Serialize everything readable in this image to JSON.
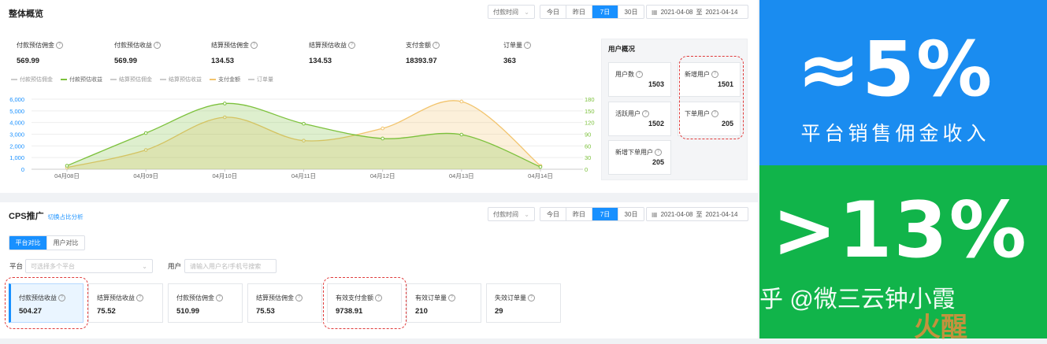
{
  "overview": {
    "title": "整体概览",
    "pay_time_label": "付款时间",
    "ranges": [
      "今日",
      "昨日",
      "7日",
      "30日"
    ],
    "active_range": "7日",
    "date_from": "2021-04-08",
    "date_sep": "至",
    "date_to": "2021-04-14",
    "metrics": [
      {
        "label": "付款预估佣金",
        "value": "569.99"
      },
      {
        "label": "付款预估收益",
        "value": "569.99"
      },
      {
        "label": "结算预估佣金",
        "value": "134.53"
      },
      {
        "label": "结算预估收益",
        "value": "134.53"
      },
      {
        "label": "支付金额",
        "value": "18393.97"
      },
      {
        "label": "订单量",
        "value": "363"
      }
    ]
  },
  "chart_data": {
    "type": "area",
    "categories": [
      "04月08日",
      "04月09日",
      "04月10日",
      "04月11日",
      "04月12日",
      "04月13日",
      "04月14日"
    ],
    "legend": [
      {
        "name": "付款预估佣金",
        "color": "#cccccc"
      },
      {
        "name": "付款预估收益",
        "color": "#7cc13c"
      },
      {
        "name": "结算预估佣金",
        "color": "#cccccc"
      },
      {
        "name": "结算预估收益",
        "color": "#cccccc"
      },
      {
        "name": "支付金额",
        "color": "#f2c46d"
      },
      {
        "name": "订单量",
        "color": "#cccccc"
      }
    ],
    "y_left": {
      "ticks": [
        "0",
        "1,000",
        "2,000",
        "3,000",
        "4,000",
        "5,000",
        "6,000"
      ],
      "min": 0,
      "max": 6000
    },
    "y_right": {
      "ticks": [
        "0",
        "30",
        "60",
        "90",
        "120",
        "150",
        "180"
      ],
      "min": 0,
      "max": 180
    },
    "series": [
      {
        "name": "付款预估收益",
        "axis": "right",
        "color": "#7cc13c",
        "values": [
          9,
          93,
          169,
          117,
          79,
          89,
          6
        ]
      },
      {
        "name": "支付金额",
        "axis": "left",
        "color": "#f2c46d",
        "values": [
          150,
          1650,
          4450,
          2450,
          3500,
          5800,
          300
        ]
      }
    ]
  },
  "user_overview": {
    "title": "用户概况",
    "items": [
      {
        "label": "用户数",
        "value": "1503"
      },
      {
        "label": "新增用户",
        "value": "1501"
      },
      {
        "label": "活跃用户",
        "value": "1502"
      },
      {
        "label": "下单用户",
        "value": "205"
      },
      {
        "label": "新增下单用户",
        "value": "205"
      }
    ]
  },
  "cps": {
    "title": "CPS推广",
    "switch_link": "切换占比分析",
    "pay_time_label": "付款时间",
    "ranges": [
      "今日",
      "昨日",
      "7日",
      "30日"
    ],
    "active_range": "7日",
    "date_from": "2021-04-08",
    "date_sep": "至",
    "date_to": "2021-04-14",
    "tabs": [
      "平台对比",
      "用户对比"
    ],
    "active_tab": "平台对比",
    "platform_label": "平台",
    "platform_placeholder": "可选择多个平台",
    "user_label": "用户",
    "user_placeholder": "请输入用户名/手机号搜索",
    "cards": [
      {
        "label": "付款预估收益",
        "value": "504.27"
      },
      {
        "label": "结算预估收益",
        "value": "75.52"
      },
      {
        "label": "付款预估佣金",
        "value": "510.99"
      },
      {
        "label": "结算预估佣金",
        "value": "75.53"
      },
      {
        "label": "有效支付金额",
        "value": "9738.91"
      },
      {
        "label": "有效订单量",
        "value": "210"
      },
      {
        "label": "失效订单量",
        "value": "29"
      }
    ]
  },
  "promo": {
    "top_big": "≈5%",
    "top_sub": "平台销售佣金收入",
    "bottom_big": ">13%",
    "watermark": "知乎 @微三云钟小霞",
    "logo_text": "火醒",
    "top_color": "#1a8cf0",
    "bottom_color": "#11b44a"
  }
}
